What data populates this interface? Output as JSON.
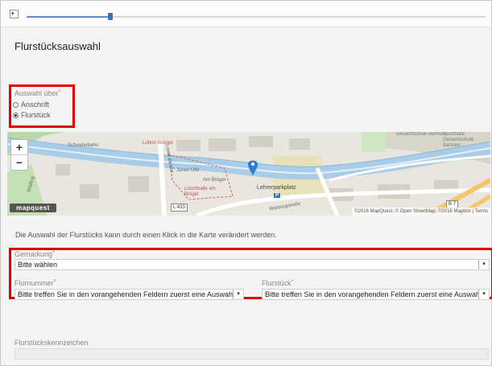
{
  "topbar": {
    "collapse_icon": "▾"
  },
  "section": {
    "title": "Flurstücksauswahl"
  },
  "auswahl": {
    "legend": "Auswahl über",
    "options": [
      {
        "label": "Anschrift",
        "checked": false
      },
      {
        "label": "Flurstück",
        "checked": true
      }
    ]
  },
  "map": {
    "zoom_in": "+",
    "zoom_out": "−",
    "logo": "mapquest",
    "attribution": "©2016 MapQuest, © Open StreetMap, ©2016 Mapbox | Terms",
    "labels": {
      "schwebebahn": "Schwebebahn",
      "lohrer_bruecke": "Lohrer Brücke",
      "junior_uni": "Junior UNI",
      "am_broeger": "Am Bröger",
      "loschhalle": "Löschhalle am Bröger",
      "lehrerparkplatz": "Lehrerparkplatz",
      "parking": "P",
      "gesamtschule": "Gesamtschule Barmen",
      "sporthalle": "Sporthalle Gesamtschule Barmen",
      "lower_strasse": "Lower Straße",
      "warburgstrasse": "Warburgstraße",
      "wuelfing": "Wülfing",
      "l433": "L 433",
      "b7": "B 7"
    }
  },
  "hint": "Die Auswahl der Flurstücks kann durch einen Klick in die Karte verändert werden.",
  "gemarkung": {
    "label": "Gemarkung",
    "value": "Bitte wählen"
  },
  "flurnummer": {
    "label": "Flurnummer",
    "value": "Bitte treffen Sie in den vorangehenden Feldern zuerst eine Auswahl"
  },
  "flurstueck": {
    "label": "Flurstück",
    "value": "Bitte treffen Sie in den vorangehenden Feldern zuerst eine Auswahl"
  },
  "kennzeichen": {
    "label": "Flurstückskennzeichen"
  },
  "required_mark": "*",
  "colors": {
    "highlight": "#e00000",
    "river": "#a9cde8",
    "accent": "#3a73b8"
  }
}
